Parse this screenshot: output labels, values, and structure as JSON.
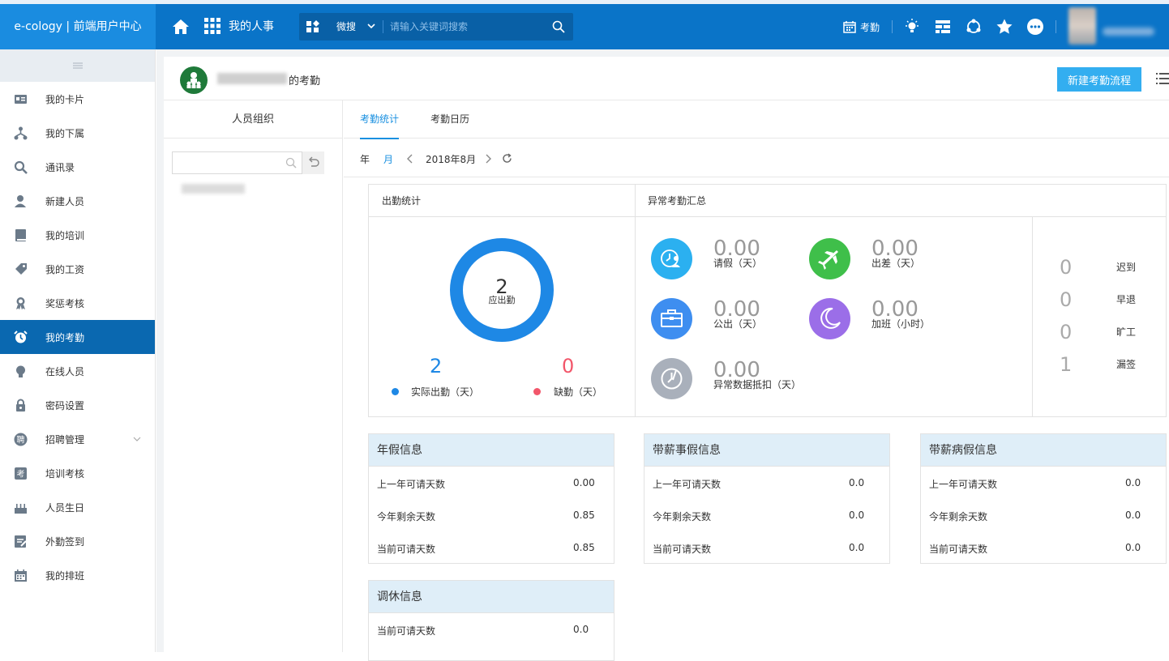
{
  "brand": "e-cology | 前端用户中心",
  "topbar": {
    "module": "我的人事",
    "search_scope": "微搜",
    "search_placeholder": "请输入关键词搜索",
    "attendance_label": "考勤"
  },
  "sidebar": {
    "items": [
      {
        "label": "我的卡片",
        "icon": "id-card-icon"
      },
      {
        "label": "我的下属",
        "icon": "org-tree-icon"
      },
      {
        "label": "通讯录",
        "icon": "search-icon"
      },
      {
        "label": "新建人员",
        "icon": "user-add-icon"
      },
      {
        "label": "我的培训",
        "icon": "book-icon"
      },
      {
        "label": "我的工资",
        "icon": "tag-icon"
      },
      {
        "label": "奖惩考核",
        "icon": "award-icon"
      },
      {
        "label": "我的考勤",
        "icon": "alarm-icon",
        "active": true
      },
      {
        "label": "在线人员",
        "icon": "bulb-icon"
      },
      {
        "label": "密码设置",
        "icon": "lock-icon"
      },
      {
        "label": "招聘管理",
        "icon": "recruit-icon",
        "expandable": true
      },
      {
        "label": "培训考核",
        "icon": "exam-icon"
      },
      {
        "label": "人员生日",
        "icon": "cake-icon"
      },
      {
        "label": "外勤签到",
        "icon": "checkin-icon"
      },
      {
        "label": "我的排班",
        "icon": "calendar-icon"
      }
    ]
  },
  "page": {
    "title_suffix": "的考勤",
    "new_button": "新建考勤流程",
    "org_title": "人员组织"
  },
  "tabs": [
    {
      "label": "考勤统计",
      "active": true
    },
    {
      "label": "考勤日历",
      "active": false
    }
  ],
  "datebar": {
    "year": "年",
    "month": "月",
    "current": "2018年8月"
  },
  "attendance": {
    "header": "出勤统计",
    "should_attend": "2",
    "should_attend_label": "应出勤",
    "actual": "2",
    "actual_label": "实际出勤（天）",
    "absent": "0",
    "absent_label": "缺勤（天）",
    "actual_color": "#1e88e5",
    "absent_color": "#f2566a"
  },
  "abnormal": {
    "header": "异常考勤汇总",
    "items": [
      {
        "value": "0.00",
        "label": "请假（天）",
        "color": "#2bb0f0",
        "icon": "leave-icon"
      },
      {
        "value": "0.00",
        "label": "出差（天）",
        "color": "#3fbf4a",
        "icon": "plane-icon"
      },
      {
        "value": "0.00",
        "label": "公出（天）",
        "color": "#3e8ef0",
        "icon": "briefcase-icon"
      },
      {
        "value": "0.00",
        "label": "加班（小时）",
        "color": "#9b6ee8",
        "icon": "moon-icon"
      },
      {
        "value": "0.00",
        "label": "异常数据抵扣（天）",
        "color": "#a9b0bb",
        "icon": "clock-icon"
      }
    ],
    "counts": [
      {
        "value": "0",
        "label": "迟到"
      },
      {
        "value": "0",
        "label": "早退"
      },
      {
        "value": "0",
        "label": "旷工"
      },
      {
        "value": "1",
        "label": "漏签"
      }
    ]
  },
  "leave_cards": [
    {
      "title": "年假信息",
      "rows": [
        {
          "k": "上一年可请天数",
          "v": "0.00"
        },
        {
          "k": "今年剩余天数",
          "v": "0.85"
        },
        {
          "k": "当前可请天数",
          "v": "0.85"
        }
      ]
    },
    {
      "title": "带薪事假信息",
      "rows": [
        {
          "k": "上一年可请天数",
          "v": "0.0"
        },
        {
          "k": "今年剩余天数",
          "v": "0.0"
        },
        {
          "k": "当前可请天数",
          "v": "0.0"
        }
      ]
    },
    {
      "title": "带薪病假信息",
      "rows": [
        {
          "k": "上一年可请天数",
          "v": "0.0"
        },
        {
          "k": "今年剩余天数",
          "v": "0.0"
        },
        {
          "k": "当前可请天数",
          "v": "0.0"
        }
      ]
    },
    {
      "title": "调休信息",
      "rows": [
        {
          "k": "当前可请天数",
          "v": "0.0"
        }
      ]
    }
  ]
}
